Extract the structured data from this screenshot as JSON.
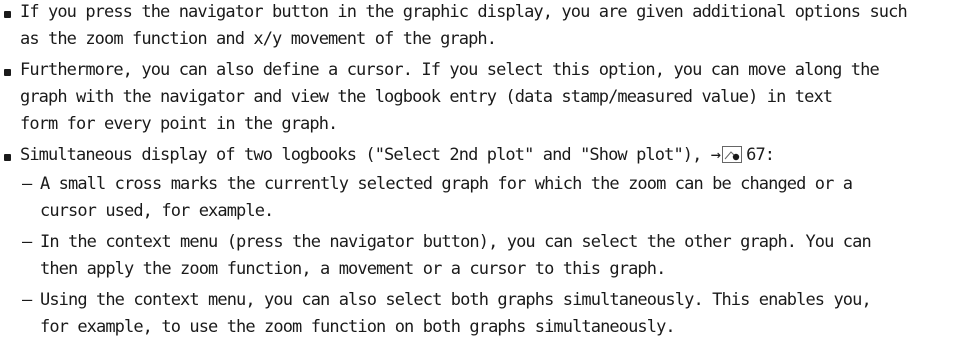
{
  "bullets": [
    {
      "lines": [
        "If you press the navigator button in the graphic display, you are given additional options such",
        "as the zoom function and x/y movement of the graph."
      ]
    },
    {
      "lines": [
        "Furthermore, you can also define a cursor. If you select this option, you can move along the",
        "graph with the navigator and view the logbook entry (data stamp/measured value) in text",
        "form for every point in the graph."
      ]
    },
    {
      "line_before_ref": "Simultaneous display of two logbooks (\"Select 2nd plot\" and \"Show plot\"), →",
      "ref_icon": "page-reference-icon",
      "ref_page": "67:",
      "subitems": [
        {
          "lines": [
            "A small cross marks the currently selected graph for which the zoom can be changed or a",
            "cursor used, for example."
          ]
        },
        {
          "lines": [
            "In the context menu (press the navigator button), you can select the other graph. You can",
            "then apply the zoom function, a movement or a cursor to this graph."
          ]
        },
        {
          "lines": [
            "Using the context menu, you can also select both graphs simultaneously. This enables you,",
            "for example, to use the zoom function on both graphs simultaneously."
          ]
        }
      ]
    }
  ],
  "dash_glyph": "–"
}
